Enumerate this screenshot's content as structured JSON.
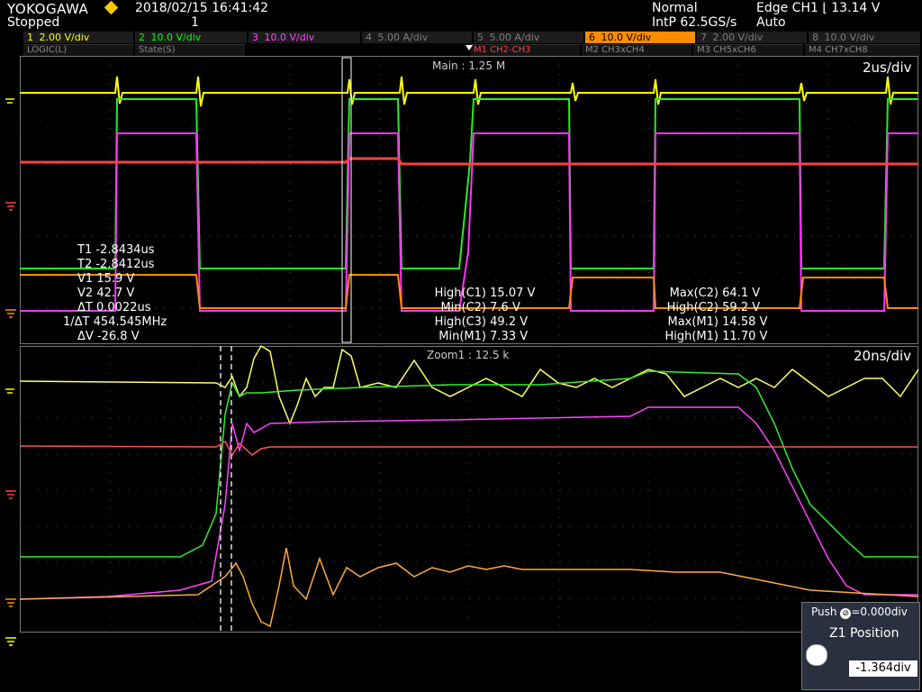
{
  "header": {
    "brand": "YOKOGAWA",
    "status": "Stopped",
    "datetime": "2018/02/15 16:41:42",
    "acq_count": "1",
    "trigger_mode": "Normal",
    "sample_rate": "IntP 62.5GS/s",
    "trigger_source": "Edge CH1 ⌊ 13.14 V",
    "trigger_auto": "Auto"
  },
  "channels": [
    {
      "num": "1",
      "scale": "2.00 V/div",
      "color": "#ffff00"
    },
    {
      "num": "2",
      "scale": "10.0 V/div",
      "color": "#00ff00"
    },
    {
      "num": "3",
      "scale": "10.0 V/div",
      "color": "#ff00ff"
    },
    {
      "num": "4",
      "scale": "5.00 A/div",
      "color": "#7f7f7f"
    },
    {
      "num": "5",
      "scale": "5.00 A/div",
      "color": "#7f7f7f"
    },
    {
      "num": "6",
      "scale": "10.0 V/div",
      "color": "#ff8c00"
    },
    {
      "num": "7",
      "scale": "2.00 V/div",
      "color": "#7f7f7f"
    },
    {
      "num": "8",
      "scale": "10.0 V/div",
      "color": "#7f7f7f"
    }
  ],
  "math_tabs": [
    "LOGIC(L)",
    "State(S)",
    "M1 CH2-CH3",
    "M2 CH3xCH4",
    "M3 CH5xCH6",
    "M4 CH7xCH8"
  ],
  "main_window": {
    "label": "Main : 1.25 M",
    "timebase": "2us/div"
  },
  "zoom_window": {
    "label": "Zoom1 : 12.5 k",
    "timebase": "20ns/div"
  },
  "cursor_measure": [
    {
      "name": "T1",
      "value": "-2.8434us"
    },
    {
      "name": "T2",
      "value": "-2.8412us"
    },
    {
      "name": "V1",
      "value": "15.9 V"
    },
    {
      "name": "V2",
      "value": "42.7 V"
    },
    {
      "name": "ΔT",
      "value": "0.0022us"
    },
    {
      "name": "1/ΔT",
      "value": "454.545MHz"
    },
    {
      "name": "ΔV",
      "value": "-26.8 V"
    }
  ],
  "params_left": [
    {
      "name": "High(C1)",
      "value": "15.07 V"
    },
    {
      "name": "Min(C2)",
      "value": "7.6 V"
    },
    {
      "name": "High(C3)",
      "value": "49.2 V"
    },
    {
      "name": "Min(M1)",
      "value": "7.33 V"
    }
  ],
  "params_right": [
    {
      "name": "Max(C2)",
      "value": "64.1 V"
    },
    {
      "name": "High(C2)",
      "value": "59.2 V"
    },
    {
      "name": "Max(M1)",
      "value": "14.58 V"
    },
    {
      "name": "High(M1)",
      "value": "11.70 V"
    }
  ],
  "control_panel": {
    "push_label": "Push",
    "push_value": "0.000div",
    "title": "Z1 Position",
    "position_value": "-1.364div"
  },
  "colors": {
    "ch1": "#ffff00",
    "ch2": "#00ff00",
    "ch3": "#ff00ff",
    "ch6": "#ff8c00",
    "m1": "#ff3030"
  }
}
